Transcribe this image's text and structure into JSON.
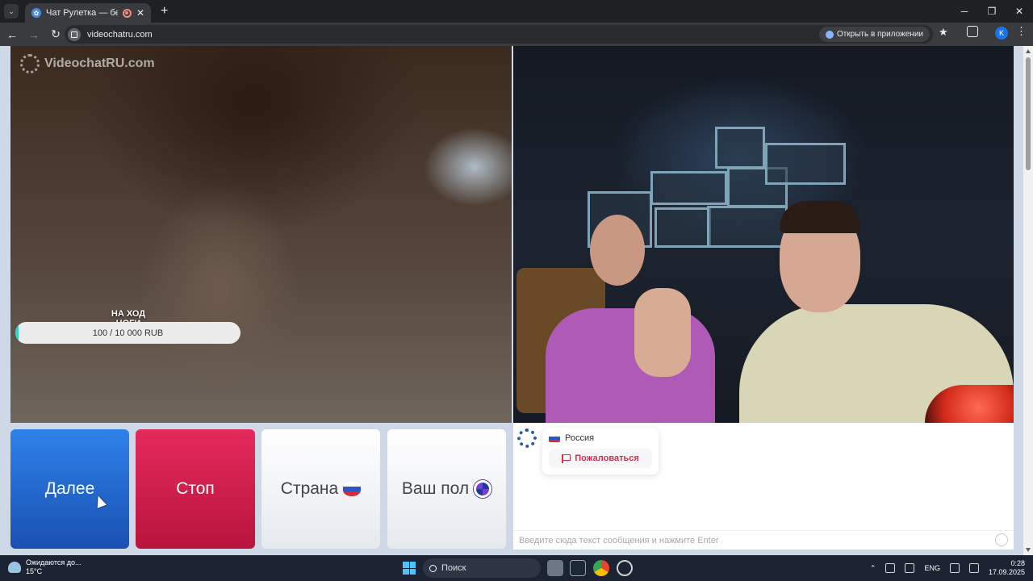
{
  "browser": {
    "tab_title": "Чат Рулетка — бесплатный",
    "url": "videochatru.com",
    "open_in_app": "Открыть в приложении",
    "profile_initial": "K"
  },
  "page": {
    "logo_text": "VideochatRU.com",
    "goal": {
      "title": "НА ХОД НОГИ",
      "progress_text": "100 / 10 000 RUB",
      "progress_fraction": 0.01
    },
    "buttons": {
      "next": "Далее",
      "stop": "Стоп",
      "country": "Страна",
      "gender": "Ваш пол"
    },
    "chat": {
      "partner_country": "Россия",
      "report_label": "Пожаловаться",
      "input_placeholder": "Введите сюда текст сообщения и нажмите Enter"
    },
    "colors": {
      "next_button": "#1f62c9",
      "stop_button": "#cf1d4a",
      "report_text": "#d0304a",
      "goal_fill": "#2ed3c6"
    }
  },
  "taskbar": {
    "weather_status": "Ожидаются до...",
    "temperature": "15°C",
    "search_label": "Поиск",
    "language": "ENG",
    "time": "0:28",
    "date": "17.09.2025"
  }
}
